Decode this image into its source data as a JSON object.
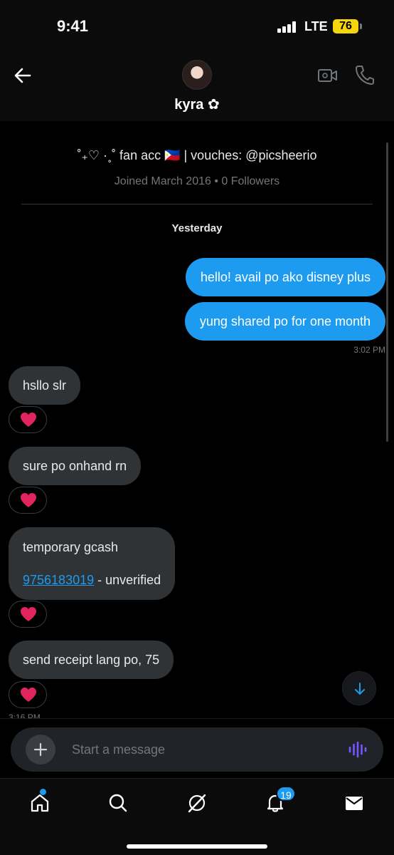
{
  "status_bar": {
    "time": "9:41",
    "network": "LTE",
    "battery": "76",
    "battery_color": "#f5d60a"
  },
  "header": {
    "contact_name": "kyra ✿",
    "icons": [
      "back-arrow-icon",
      "video-call-icon",
      "phone-icon"
    ]
  },
  "profile": {
    "bio": "˚₊♡ ·˳˚ fan acc 🇵🇭 | vouches: @picsheerio",
    "joined": "Joined March 2016 • 0 Followers"
  },
  "conversation": {
    "day_label": "Yesterday",
    "outgoing": [
      {
        "text": "hello! avail po ako disney plus"
      },
      {
        "text": "yung shared po for one month"
      }
    ],
    "outgoing_time": "3:02 PM",
    "incoming": [
      {
        "text": "hsllo slr",
        "reaction": "❤️"
      },
      {
        "text": "sure po onhand rn",
        "reaction": "❤️"
      },
      {
        "line1": "temporary gcash",
        "link": "9756183019",
        "suffix": " - unverified",
        "reaction": "❤️"
      },
      {
        "text": "send receipt lang po, 75",
        "reaction": "❤️"
      }
    ],
    "last_time": "3:16 PM"
  },
  "composer": {
    "placeholder": "Start a message"
  },
  "tab_bar": {
    "items": [
      "home",
      "search",
      "grok",
      "notifications",
      "messages"
    ],
    "notifications_count": "19"
  },
  "colors": {
    "accent": "#1d9bf0",
    "incoming_bubble": "#2f3336",
    "background": "#000000",
    "voice_icon": "#7856ff",
    "heart": "#e0245e"
  }
}
